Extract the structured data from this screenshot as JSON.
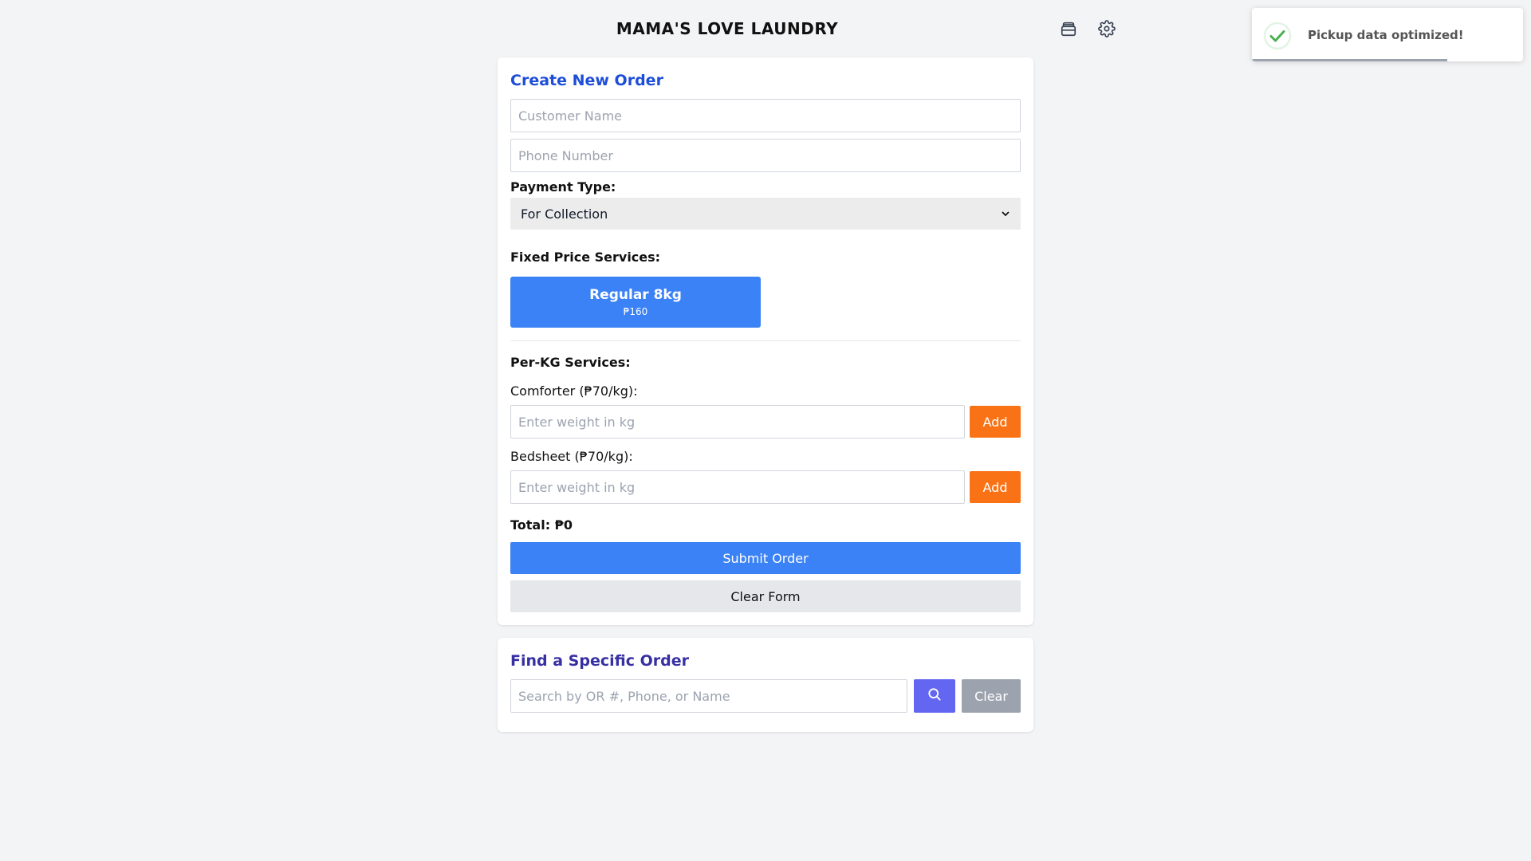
{
  "header": {
    "title": "MAMA'S LOVE LAUNDRY",
    "icons": [
      "archive-icon",
      "gear-icon"
    ]
  },
  "order_form": {
    "title": "Create New Order",
    "customer_name_placeholder": "Customer Name",
    "customer_name_value": "",
    "phone_placeholder": "Phone Number",
    "phone_value": "",
    "payment_type_label": "Payment Type:",
    "payment_type_selected": "For Collection",
    "fixed_services_label": "Fixed Price Services:",
    "fixed_services": [
      {
        "name": "Regular 8kg",
        "price": "₱160"
      }
    ],
    "per_kg_label": "Per-KG Services:",
    "per_kg_services": [
      {
        "label": "Comforter (₱70/kg):",
        "placeholder": "Enter weight in kg",
        "add_label": "Add"
      },
      {
        "label": "Bedsheet (₱70/kg):",
        "placeholder": "Enter weight in kg",
        "add_label": "Add"
      }
    ],
    "total_text": "Total: ₱0",
    "submit_label": "Submit Order",
    "clear_label": "Clear Form"
  },
  "find_order": {
    "title": "Find a Specific Order",
    "search_placeholder": "Search by OR #, Phone, or Name",
    "search_icon": "search-icon",
    "clear_label": "Clear"
  },
  "toast": {
    "message": "Pickup data optimized!",
    "icon": "check-circle-icon",
    "progress_remaining": 0.72
  },
  "colors": {
    "primary_blue": "#3b82f6",
    "title_blue": "#1d4ed8",
    "indigo": "#6366f1",
    "orange": "#f97316",
    "success_green": "#4caf50"
  }
}
